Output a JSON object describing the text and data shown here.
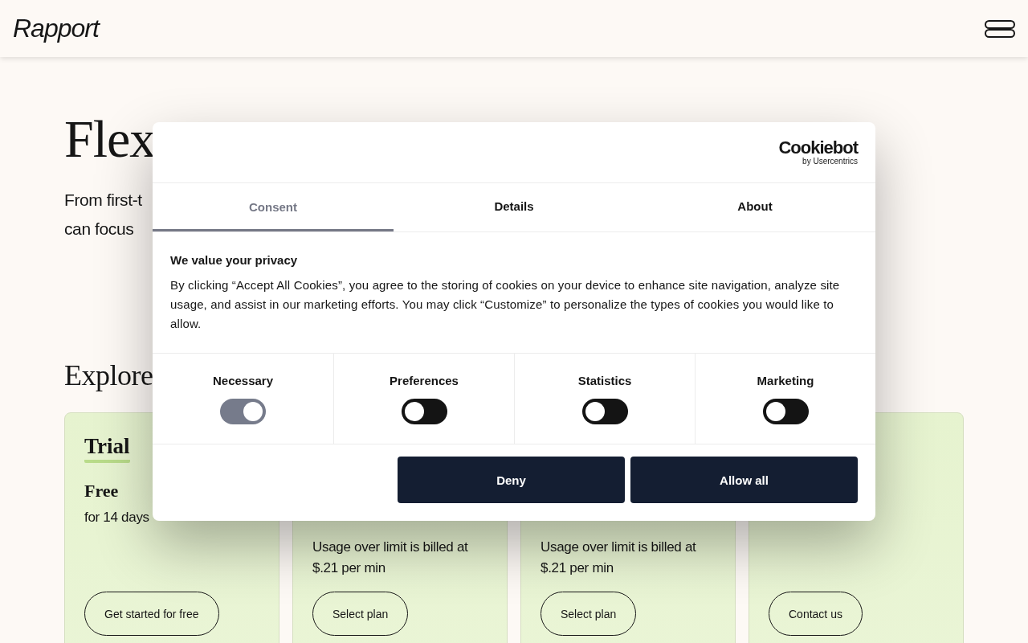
{
  "header": {
    "logo": "Rapport"
  },
  "hero": {
    "title": "Flex",
    "subtitle_lines": [
      "From first-t",
      "can focus"
    ]
  },
  "section_title": "Explore",
  "plans": [
    {
      "name": "Trial",
      "price": "Free",
      "period": "for 14 days",
      "button": "Get started for free"
    },
    {
      "note_lines": [
        "Usage over limit is billed at",
        "$.21 per min"
      ],
      "button": "Select plan"
    },
    {
      "note_lines": [
        "Usage over limit is billed at",
        "$.21 per min"
      ],
      "button": "Select plan"
    },
    {
      "button": "Contact us"
    }
  ],
  "cookie_dialog": {
    "brand": "Cookiebot",
    "brand_sub": "by Usercentrics",
    "tabs": [
      {
        "label": "Consent",
        "selected": true
      },
      {
        "label": "Details",
        "selected": false
      },
      {
        "label": "About",
        "selected": false
      }
    ],
    "heading": "We value your privacy",
    "text": "By clicking “Accept All Cookies”, you agree to the storing of cookies on your device to enhance site navigation, analyze site usage, and assist in our marketing efforts. You may click “Customize” to personalize the types of cookies you would like to allow.",
    "categories": [
      {
        "label": "Necessary",
        "checked": true,
        "disabled": true
      },
      {
        "label": "Preferences",
        "checked": false,
        "disabled": false
      },
      {
        "label": "Statistics",
        "checked": false,
        "disabled": false
      },
      {
        "label": "Marketing",
        "checked": false,
        "disabled": false
      }
    ],
    "buttons": [
      "Deny",
      "Allow all"
    ]
  }
}
